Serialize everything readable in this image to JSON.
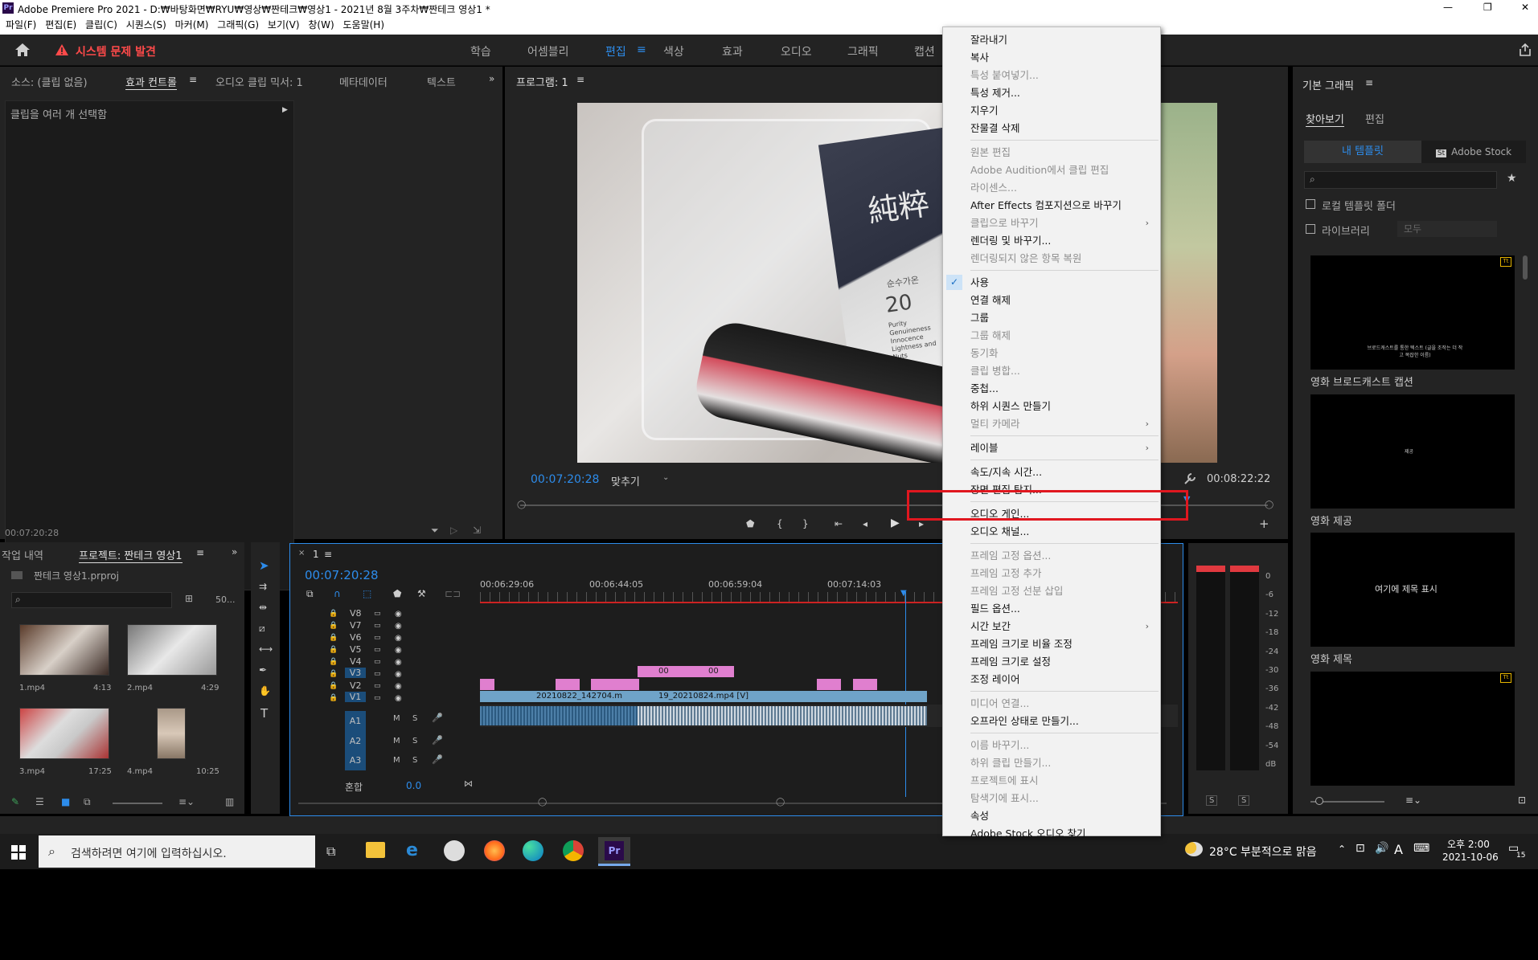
{
  "app": {
    "logo": "Pr",
    "title": "Adobe Premiere Pro 2021 - D:₩바탕화면₩RYU₩영상₩짠테크₩영상1 - 2021년 8월 3주차₩짠테크 영상1 *",
    "win_controls": [
      "—",
      "❐",
      "✕"
    ]
  },
  "menu": [
    "파일(F)",
    "편집(E)",
    "클립(C)",
    "시퀀스(S)",
    "마커(M)",
    "그래픽(G)",
    "보기(V)",
    "창(W)",
    "도움말(H)"
  ],
  "workspace": {
    "home_icon": "home-icon",
    "alert": "시스템 문제 발견",
    "tabs": [
      "학습",
      "어셈블리",
      "편집",
      "색상",
      "효과",
      "오디오",
      "그래픽",
      "캡션"
    ],
    "active_tab": "편집"
  },
  "effect_panel": {
    "tabs": [
      "소스: (클립 없음)",
      "효과 컨트롤",
      "오디오 클립 믹서: 1",
      "메타데이터",
      "텍스트"
    ],
    "message": "클립을 여러 개 선택함",
    "timecode": "00:07:20:28"
  },
  "program": {
    "title": "프로그램: 1",
    "timecode_left": "00:07:20:28",
    "fit": "맞추기",
    "timecode_right": "00:08:22:22",
    "frame_text": [
      "純粹",
      "순수가온",
      "20",
      "Purity Genuineness Innocence Lightness and Nuts"
    ]
  },
  "project": {
    "tabs": [
      "작업 내역",
      "프로젝트: 짠테크 영상1"
    ],
    "file": "짠테크 영상1.prproj",
    "count": "50...",
    "clips": [
      {
        "name": "1.mp4",
        "dur": "4:13"
      },
      {
        "name": "2.mp4",
        "dur": "4:29"
      },
      {
        "name": "3.mp4",
        "dur": "17:25"
      },
      {
        "name": "4.mp4",
        "dur": "10:25"
      }
    ]
  },
  "timeline": {
    "seq": "1",
    "timecode": "00:07:20:28",
    "ruler": [
      "00:06:29:06",
      "00:06:44:05",
      "00:06:59:04",
      "00:07:14:03"
    ],
    "video_tracks": [
      "V8",
      "V7",
      "V6",
      "V5",
      "V4",
      "V3",
      "V2",
      "V1"
    ],
    "audio_tracks": [
      "A1",
      "A2",
      "A3"
    ],
    "mix": "혼합",
    "mix_val": "0.0",
    "clip_labels": [
      "20210822_142704.m",
      "19_20210824.mp4 [V]",
      "00",
      "00"
    ],
    "ms": [
      "M",
      "S"
    ]
  },
  "meter": {
    "scale": [
      "0",
      "-6",
      "-12",
      "-18",
      "-24",
      "-30",
      "-36",
      "-42",
      "-48",
      "-54",
      "dB"
    ],
    "solo": [
      "S",
      "S"
    ]
  },
  "graphics": {
    "title": "기본 그래픽",
    "tabs": [
      "찾아보기",
      "편집"
    ],
    "sub_tabs": [
      "내 템플릿",
      "Adobe Stock"
    ],
    "check_local": "로컬 템플릿 폴더",
    "check_lib": "라이브러리",
    "lib_select": "모두",
    "templates": [
      {
        "name": "영화 브로드캐스트 캡션",
        "inner": "브로드캐스트를 통한 텍스트 (글을 조작는 더 작고 복잡한 이름)"
      },
      {
        "name": "영화 제공",
        "inner": "제공"
      },
      {
        "name": "영화 제목",
        "inner": "여기에 제목 표시"
      },
      {
        "name": "",
        "inner": ""
      }
    ]
  },
  "context_menu": {
    "items": [
      {
        "label": "잘라내기",
        "dis": false
      },
      {
        "label": "복사",
        "dis": false
      },
      {
        "label": "특성 붙여넣기...",
        "dis": true
      },
      {
        "label": "특성 제거...",
        "dis": false
      },
      {
        "label": "지우기",
        "dis": false
      },
      {
        "label": "잔물결 삭제",
        "dis": false
      },
      {
        "sep": true
      },
      {
        "label": "원본 편집",
        "dis": true
      },
      {
        "label": "Adobe Audition에서 클립 편집",
        "dis": true
      },
      {
        "label": "라이센스...",
        "dis": true
      },
      {
        "label": "After Effects 컴포지션으로 바꾸기",
        "dis": false
      },
      {
        "label": "클립으로 바꾸기",
        "dis": true,
        "sub": true
      },
      {
        "label": "렌더링 및 바꾸기...",
        "dis": false
      },
      {
        "label": "렌더링되지 않은 항목 복원",
        "dis": true
      },
      {
        "sep": true
      },
      {
        "label": "사용",
        "dis": false,
        "check": true
      },
      {
        "label": "연결 해제",
        "dis": false
      },
      {
        "label": "그룹",
        "dis": false
      },
      {
        "label": "그룹 해제",
        "dis": true
      },
      {
        "label": "동기화",
        "dis": true
      },
      {
        "label": "클립 병합...",
        "dis": true
      },
      {
        "label": "중첩...",
        "dis": false
      },
      {
        "label": "하위 시퀀스 만들기",
        "dis": false
      },
      {
        "label": "멀티 카메라",
        "dis": true,
        "sub": true
      },
      {
        "sep": true
      },
      {
        "label": "레이블",
        "dis": false,
        "sub": true
      },
      {
        "sep": true
      },
      {
        "label": "속도/지속 시간...",
        "dis": false
      },
      {
        "label": "장면 편집 탐지...",
        "dis": false
      },
      {
        "sep": true
      },
      {
        "label": "오디오 게인...",
        "dis": false,
        "highlight": true
      },
      {
        "label": "오디오 채널...",
        "dis": false
      },
      {
        "sep": true
      },
      {
        "label": "프레임 고정 옵션...",
        "dis": true
      },
      {
        "label": "프레임 고정 추가",
        "dis": true
      },
      {
        "label": "프레임 고정 선분 삽입",
        "dis": true
      },
      {
        "label": "필드 옵션...",
        "dis": false
      },
      {
        "label": "시간 보간",
        "dis": false,
        "sub": true
      },
      {
        "label": "프레임 크기로 비율 조정",
        "dis": false
      },
      {
        "label": "프레임 크기로 설정",
        "dis": false
      },
      {
        "label": "조정 레이어",
        "dis": false
      },
      {
        "sep": true
      },
      {
        "label": "미디어 연결...",
        "dis": true
      },
      {
        "label": "오프라인 상태로 만들기...",
        "dis": false
      },
      {
        "sep": true
      },
      {
        "label": "이름 바꾸기...",
        "dis": true
      },
      {
        "label": "하위 클립 만들기...",
        "dis": true
      },
      {
        "label": "프로젝트에 표시",
        "dis": true
      },
      {
        "label": "탐색기에 표시...",
        "dis": true
      },
      {
        "label": "속성",
        "dis": false
      },
      {
        "label": "Adobe Stock 오디오 찾기",
        "dis": false
      }
    ]
  },
  "taskbar": {
    "search_placeholder": "검색하려면 여기에 입력하십시오.",
    "weather": "28°C 부분적으로 맑음",
    "time": "오후 2:00",
    "date": "2021-10-06",
    "ime": "A",
    "notif": "15",
    "apps": [
      "task-view-icon",
      "file-explorer-icon",
      "ie-icon",
      "app-icon",
      "firefox-icon",
      "edge-icon",
      "chrome-icon",
      "premiere-icon"
    ]
  },
  "colors": {
    "accent": "#2d8ceb",
    "highlight_box": "#e0171f",
    "alert": "#ff4a4a",
    "clip_pink": "#e07fcf",
    "clip_blue": "#6fa3c8",
    "clip_green": "#3fa35b"
  }
}
